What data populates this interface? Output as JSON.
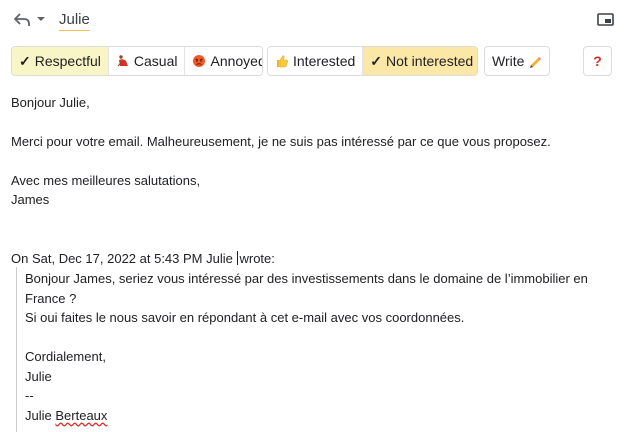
{
  "header": {
    "recipient": "Julie",
    "icons": [
      "reply-icon",
      "chevron-down-icon",
      "pop-out-icon"
    ]
  },
  "toolbar": {
    "tones": [
      {
        "label": "Respectful",
        "icon": "check-icon",
        "selected": true
      },
      {
        "label": "Casual",
        "icon": "dancer-emoji",
        "selected": false
      },
      {
        "label": "Annoyed",
        "icon": "angry-face-emoji",
        "selected": false
      }
    ],
    "intents": [
      {
        "label": "Interested",
        "icon": "thumbs-up-emoji",
        "selected": false
      },
      {
        "label": "Not interested",
        "icon": "check-icon",
        "selected": true
      }
    ],
    "write_label": "Write",
    "write_icon": "pencil-icon",
    "help_label": "?"
  },
  "reply": {
    "greeting": "Bonjour Julie,",
    "body": "Merci pour votre email. Malheureusement, je ne suis pas intéressé par ce que vous proposez.",
    "closing": "Avec mes meilleures salutations,",
    "signature": "James"
  },
  "quoted": {
    "attribution_prefix": "On Sat, Dec 17, 2022 at 5:43 PM Julie",
    "attribution_suffix": "wrote:",
    "lines": [
      "Bonjour James, seriez vous intéressé par des investissements dans le domaine de l’immobilier en",
      "France ?",
      "Si oui faites le nous savoir en répondant à cet e-mail avec vos coordonnées.",
      "",
      "Cordialement,",
      "Julie",
      "--"
    ],
    "sig_first": "Julie",
    "sig_last": "Berteaux"
  },
  "colors": {
    "tone_selected": "#f8f6c6",
    "intent_selected": "#fbe7a6",
    "help_red": "#d93025"
  }
}
